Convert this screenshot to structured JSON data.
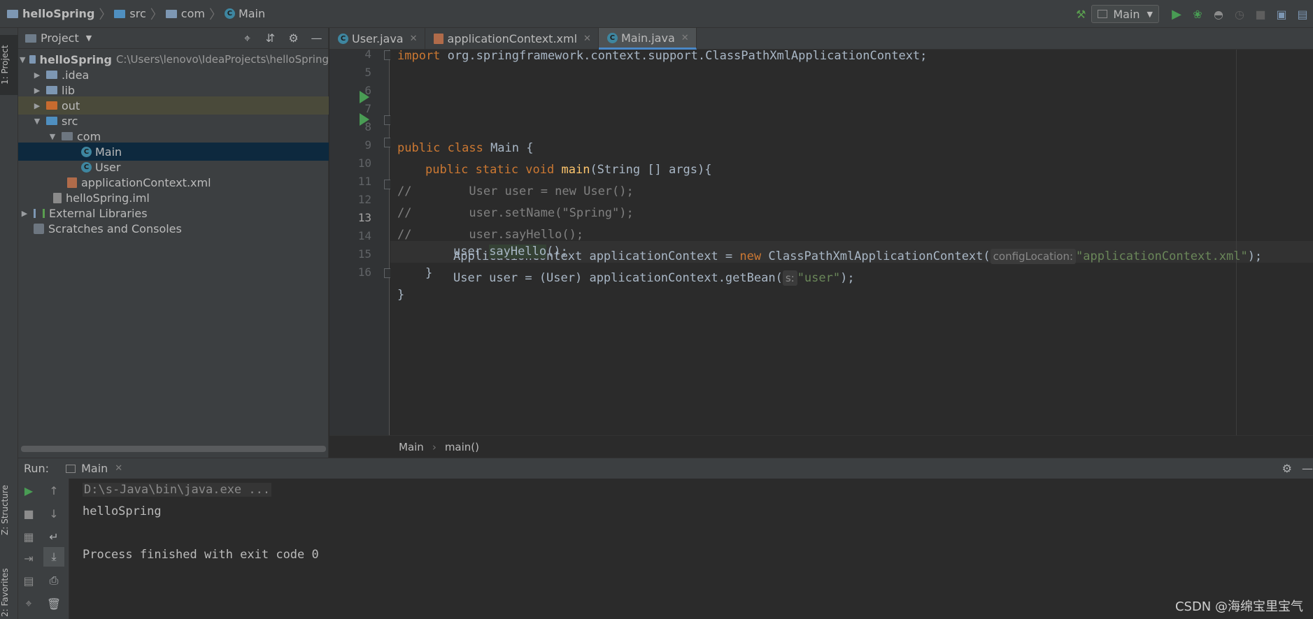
{
  "navbar": {
    "project": "helloSpring",
    "folder1": "src",
    "folder2": "com",
    "file": "Main",
    "run_config": "Main"
  },
  "leftstrip": {
    "project_tab": "1: Project",
    "structure_tab": "Z: Structure",
    "favorites_tab": "2: Favorites"
  },
  "project_panel": {
    "title": "Project",
    "tree": [
      {
        "label": "helloSpring",
        "hint": "C:\\Users\\lenovo\\IdeaProjects\\helloSpring"
      },
      {
        "label": ".idea"
      },
      {
        "label": "lib"
      },
      {
        "label": "out"
      },
      {
        "label": "src"
      },
      {
        "label": "com"
      },
      {
        "label": "Main"
      },
      {
        "label": "User"
      },
      {
        "label": "applicationContext.xml"
      },
      {
        "label": "helloSpring.iml"
      },
      {
        "label": "External Libraries"
      },
      {
        "label": "Scratches and Consoles"
      }
    ]
  },
  "editor": {
    "tabs": [
      "User.java",
      "applicationContext.xml",
      "Main.java"
    ],
    "line_numbers": [
      "4",
      "5",
      "6",
      "7",
      "8",
      "9",
      "10",
      "11",
      "12",
      "13",
      "14",
      "15",
      "16"
    ],
    "code": {
      "l4_kw": "import",
      "l4_rest": " org.springframework.context.support.ClassPathXmlApplicationContext;",
      "l6_kw": "public class",
      "l6_rest": " Main {",
      "l7_kw": "public static void",
      "l7_fn": "main",
      "l7_rest": "(String [] args){",
      "l8": "//        User user = new User();",
      "l9": "//        user.setName(\"Spring\");",
      "l10": "//        user.sayHello();",
      "l11_a": "ApplicationContext applicationContext = ",
      "l11_kw": "new",
      "l11_b": " ClassPathXmlApplicationContext(",
      "l11_hint": "configLocation:",
      "l11_str": "\"applicationContext.xml\"",
      "l11_end": ");",
      "l12_a": "User user = (User) applicationContext.getBean(",
      "l12_hint": "s:",
      "l12_str": "\"user\"",
      "l12_end": ");",
      "l13_a": "user.",
      "l13_fn": "sayHello",
      "l13_end": "();",
      "l14": "}",
      "l15": "}"
    },
    "breadcrumb": [
      "Main",
      "main()"
    ]
  },
  "run_panel": {
    "label": "Run:",
    "tab": "Main",
    "console": [
      "D:\\s-Java\\bin\\java.exe ...",
      "helloSpring",
      "Process finished with exit code 0"
    ]
  },
  "watermark": "CSDN @海绵宝里宝气"
}
